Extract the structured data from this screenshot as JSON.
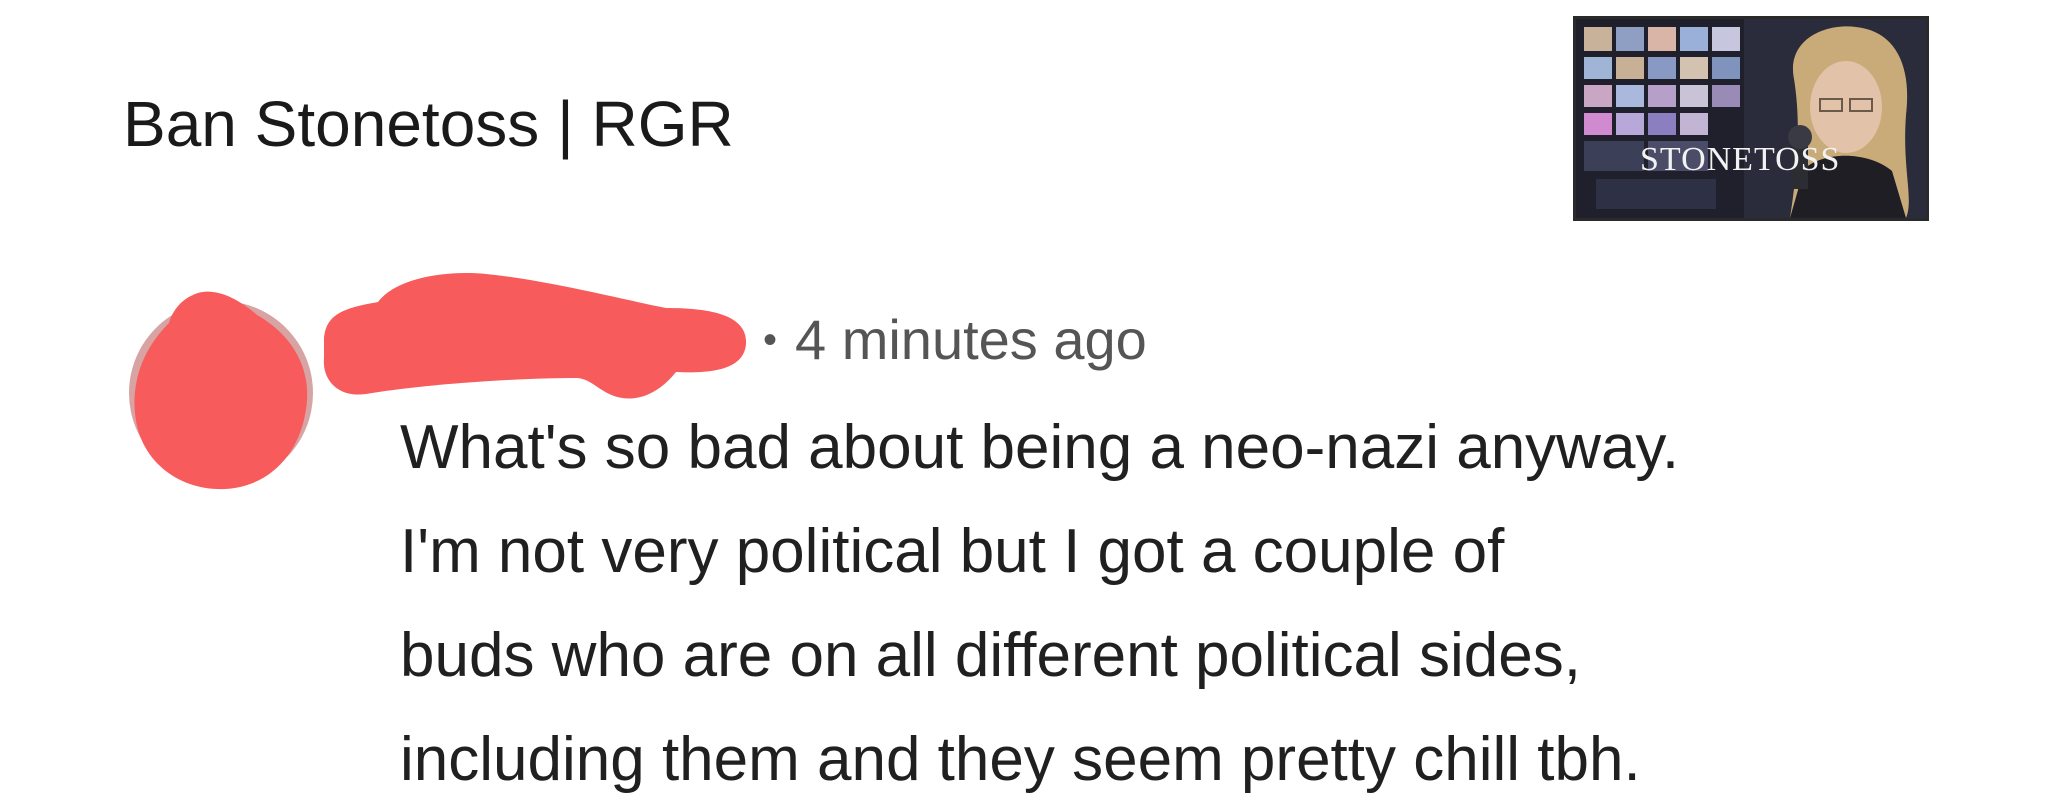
{
  "video": {
    "title": "Ban Stonetoss | RGR",
    "thumbnail_caption": "STONETOSS"
  },
  "comment": {
    "author_redacted": true,
    "separator": "•",
    "timestamp": "4 minutes ago",
    "lines": [
      "What's so bad about being a neo-nazi anyway.",
      "I'm not very political but I got a couple of",
      "buds who are on all different political sides,",
      "including them and they seem pretty chill tbh."
    ]
  },
  "colors": {
    "redaction": "#f75b5b",
    "avatar_ring": "#d8a3a3",
    "text_primary": "#1f1f1f",
    "text_meta": "#555555"
  },
  "icons": {
    "avatar": "redacted-avatar-icon",
    "author": "redacted-name-mark"
  }
}
